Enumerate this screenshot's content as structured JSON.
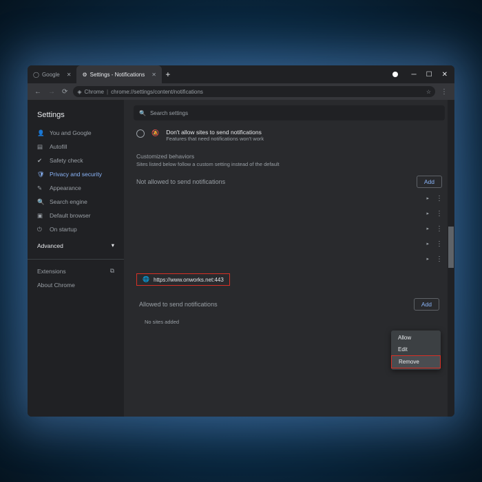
{
  "tabs": [
    {
      "label": "Google",
      "active": false
    },
    {
      "label": "Settings - Notifications",
      "active": true
    }
  ],
  "address": {
    "scheme_label": "Chrome",
    "url": "chrome://settings/content/notifications"
  },
  "settings_title": "Settings",
  "sidebar": {
    "items": [
      {
        "label": "You and Google"
      },
      {
        "label": "Autofill"
      },
      {
        "label": "Safety check"
      },
      {
        "label": "Privacy and security",
        "active": true
      },
      {
        "label": "Appearance"
      },
      {
        "label": "Search engine"
      },
      {
        "label": "Default browser"
      },
      {
        "label": "On startup"
      }
    ],
    "advanced": "Advanced",
    "extensions": "Extensions",
    "about": "About Chrome"
  },
  "search_placeholder": "Search settings",
  "radio": {
    "title": "Don't allow sites to send notifications",
    "subtitle": "Features that need notifications won't work"
  },
  "customized": {
    "heading": "Customized behaviors",
    "subtitle": "Sites listed below follow a custom setting instead of the default"
  },
  "not_allowed": {
    "heading": "Not allowed to send notifications",
    "add_label": "Add",
    "highlighted_site": "https://www.onworks.net:443"
  },
  "context_menu": {
    "items": [
      "Allow",
      "Edit",
      "Remove"
    ],
    "highlighted": "Remove"
  },
  "allowed": {
    "heading": "Allowed to send notifications",
    "add_label": "Add",
    "empty": "No sites added"
  }
}
